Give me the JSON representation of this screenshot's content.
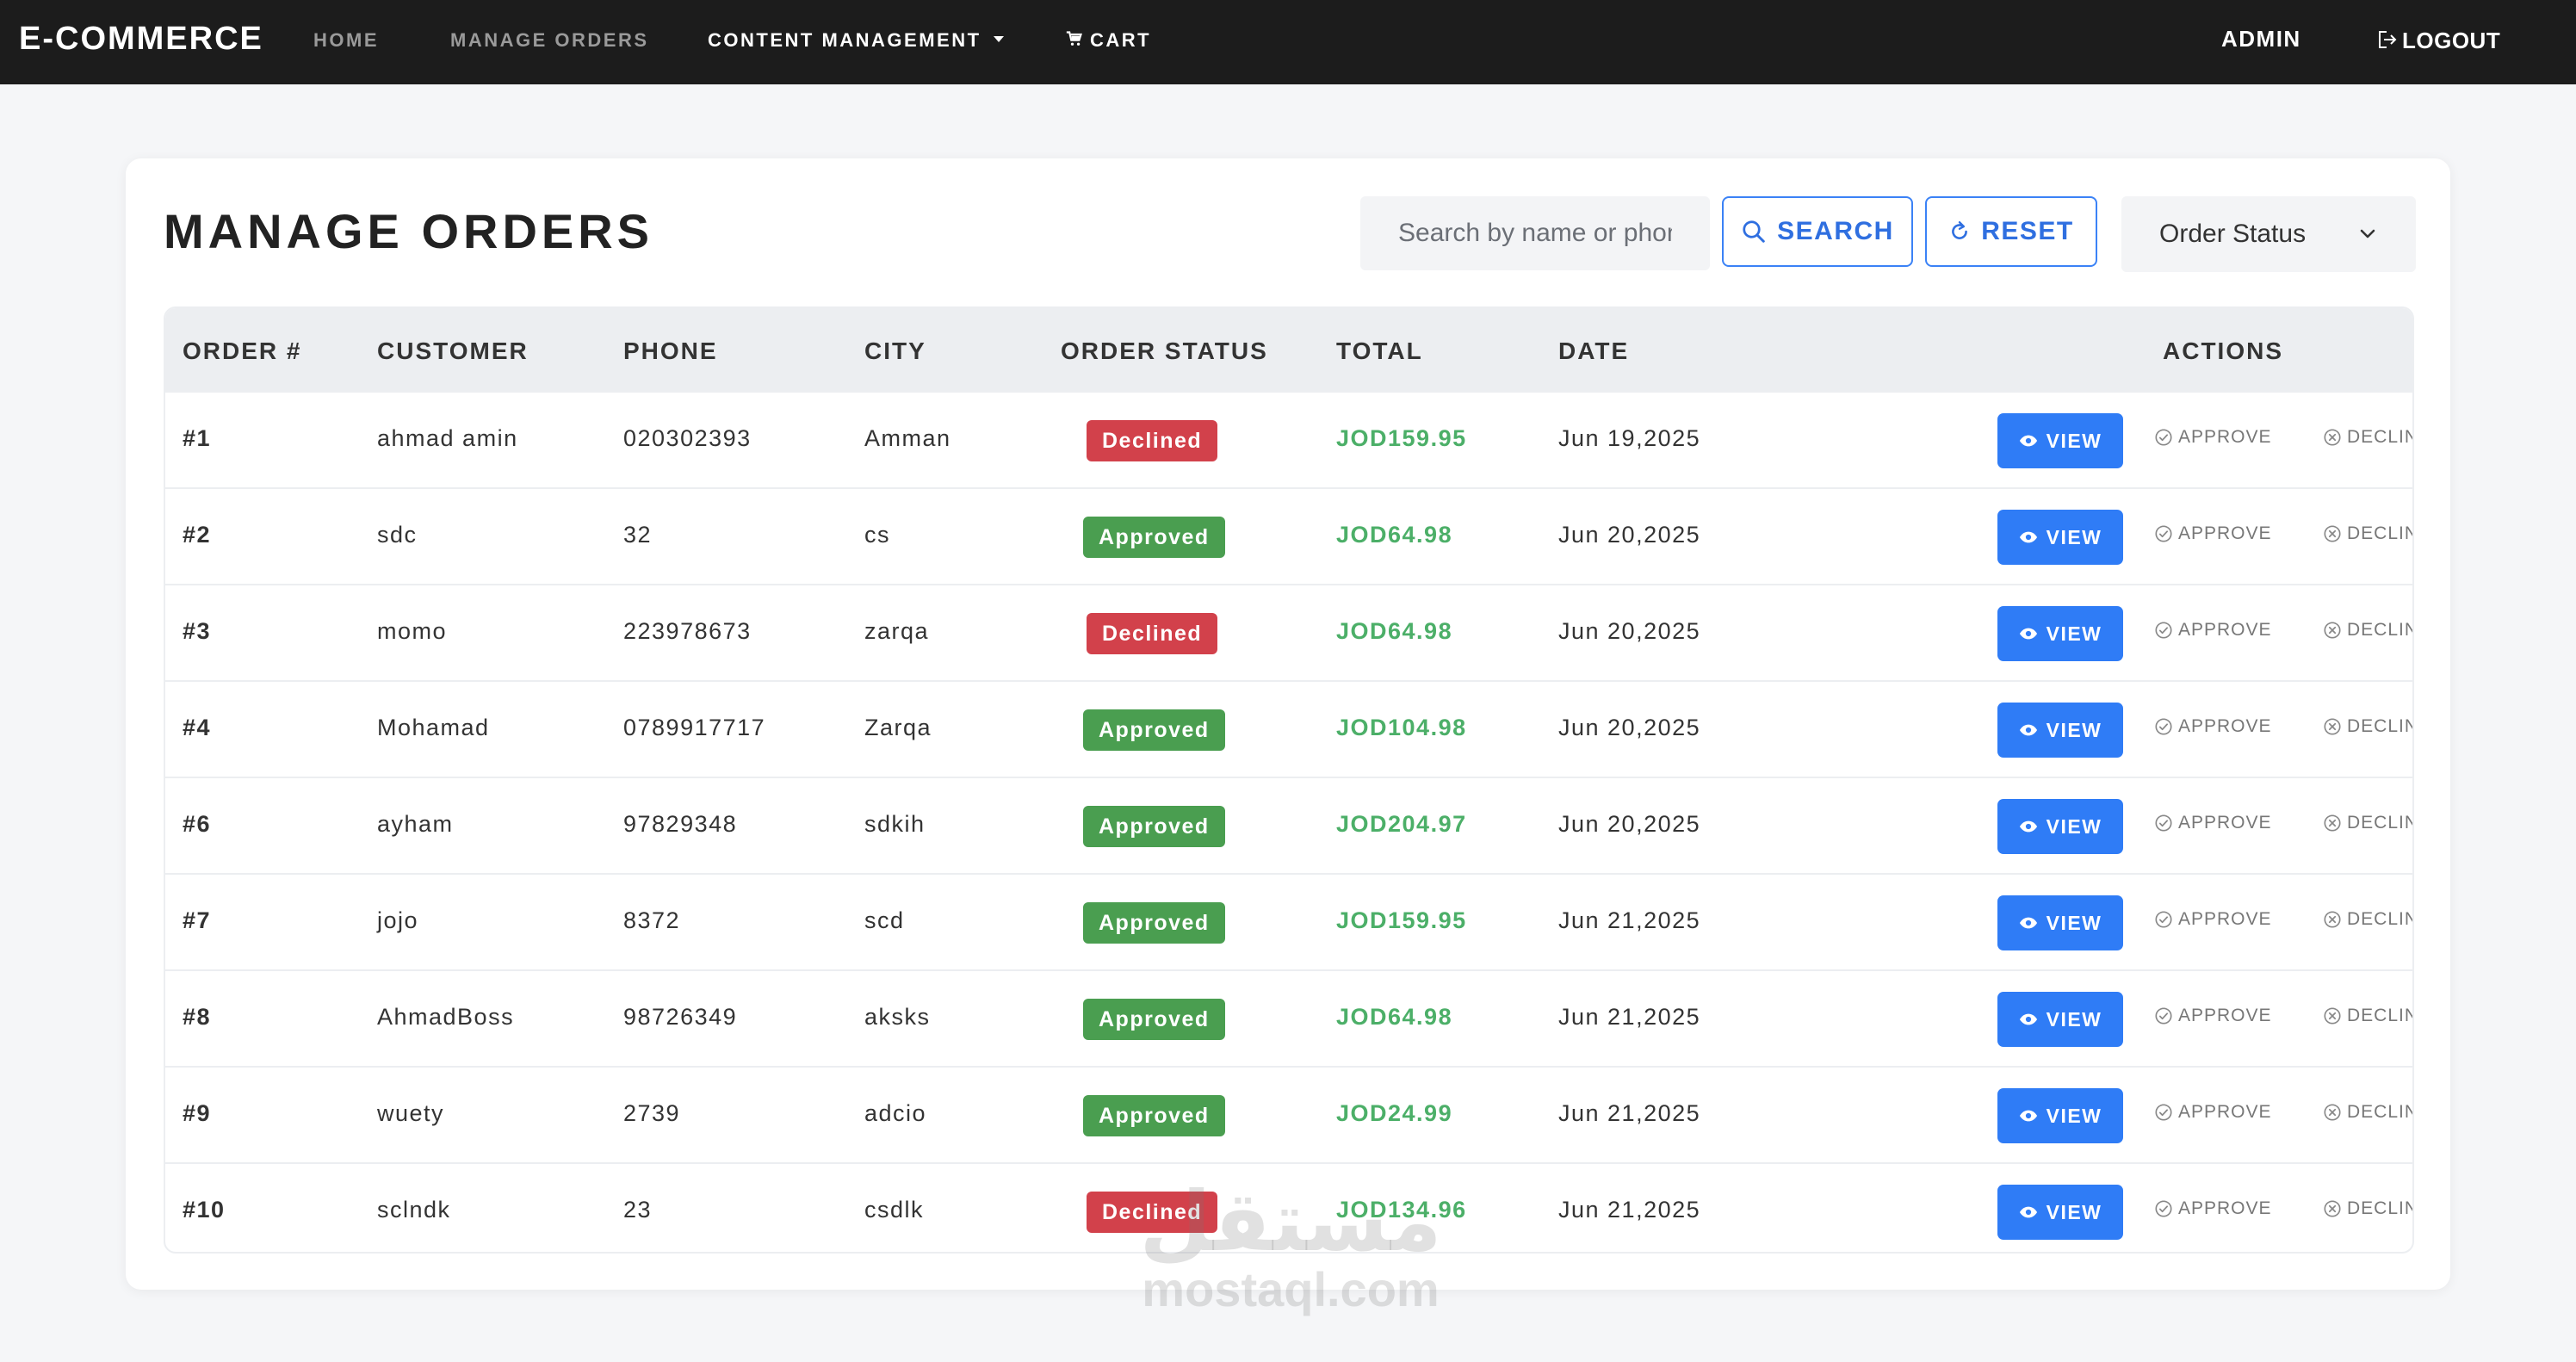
{
  "nav": {
    "brand": "E-COMMERCE",
    "home": "HOME",
    "manage_orders": "MANAGE ORDERS",
    "content_management": "CONTENT MANAGEMENT",
    "cart": "CART",
    "admin": "ADMIN",
    "logout": "LOGOUT"
  },
  "page": {
    "title": "MANAGE ORDERS",
    "search_placeholder": "Search by name or phone",
    "search_label": "SEARCH",
    "reset_label": "RESET",
    "status_filter": "Order Status"
  },
  "table": {
    "headers": {
      "order": "ORDER #",
      "customer": "CUSTOMER",
      "phone": "PHONE",
      "city": "CITY",
      "status": "ORDER STATUS",
      "total": "TOTAL",
      "date": "DATE",
      "actions": "ACTIONS"
    },
    "actions": {
      "view": "VIEW",
      "approve": "APPROVE",
      "decline": "DECLINE"
    },
    "rows": [
      {
        "order": "#1",
        "customer": "ahmad amin",
        "phone": "020302393",
        "city": "Amman",
        "status": "Declined",
        "total": "JOD159.95",
        "date": "Jun 19,2025"
      },
      {
        "order": "#2",
        "customer": "sdc",
        "phone": "32",
        "city": "cs",
        "status": "Approved",
        "total": "JOD64.98",
        "date": "Jun 20,2025"
      },
      {
        "order": "#3",
        "customer": "momo",
        "phone": "223978673",
        "city": "zarqa",
        "status": "Declined",
        "total": "JOD64.98",
        "date": "Jun 20,2025"
      },
      {
        "order": "#4",
        "customer": "Mohamad",
        "phone": "0789917717",
        "city": "Zarqa",
        "status": "Approved",
        "total": "JOD104.98",
        "date": "Jun 20,2025"
      },
      {
        "order": "#6",
        "customer": "ayham",
        "phone": "97829348",
        "city": "sdkih",
        "status": "Approved",
        "total": "JOD204.97",
        "date": "Jun 20,2025"
      },
      {
        "order": "#7",
        "customer": "jojo",
        "phone": "8372",
        "city": "scd",
        "status": "Approved",
        "total": "JOD159.95",
        "date": "Jun 21,2025"
      },
      {
        "order": "#8",
        "customer": "AhmadBoss",
        "phone": "98726349",
        "city": "aksks",
        "status": "Approved",
        "total": "JOD64.98",
        "date": "Jun 21,2025"
      },
      {
        "order": "#9",
        "customer": "wuety",
        "phone": "2739",
        "city": "adcio",
        "status": "Approved",
        "total": "JOD24.99",
        "date": "Jun 21,2025"
      },
      {
        "order": "#10",
        "customer": "sclndk",
        "phone": "23",
        "city": "csdlk",
        "status": "Declined",
        "total": "JOD134.96",
        "date": "Jun 21,2025"
      }
    ]
  },
  "colors": {
    "approved": "#4a9e50",
    "declined": "#d2414b",
    "accent": "#2f7cf6",
    "total": "#4caf68"
  },
  "watermark": {
    "logo": "مستقل",
    "text": "mostaql.com"
  }
}
